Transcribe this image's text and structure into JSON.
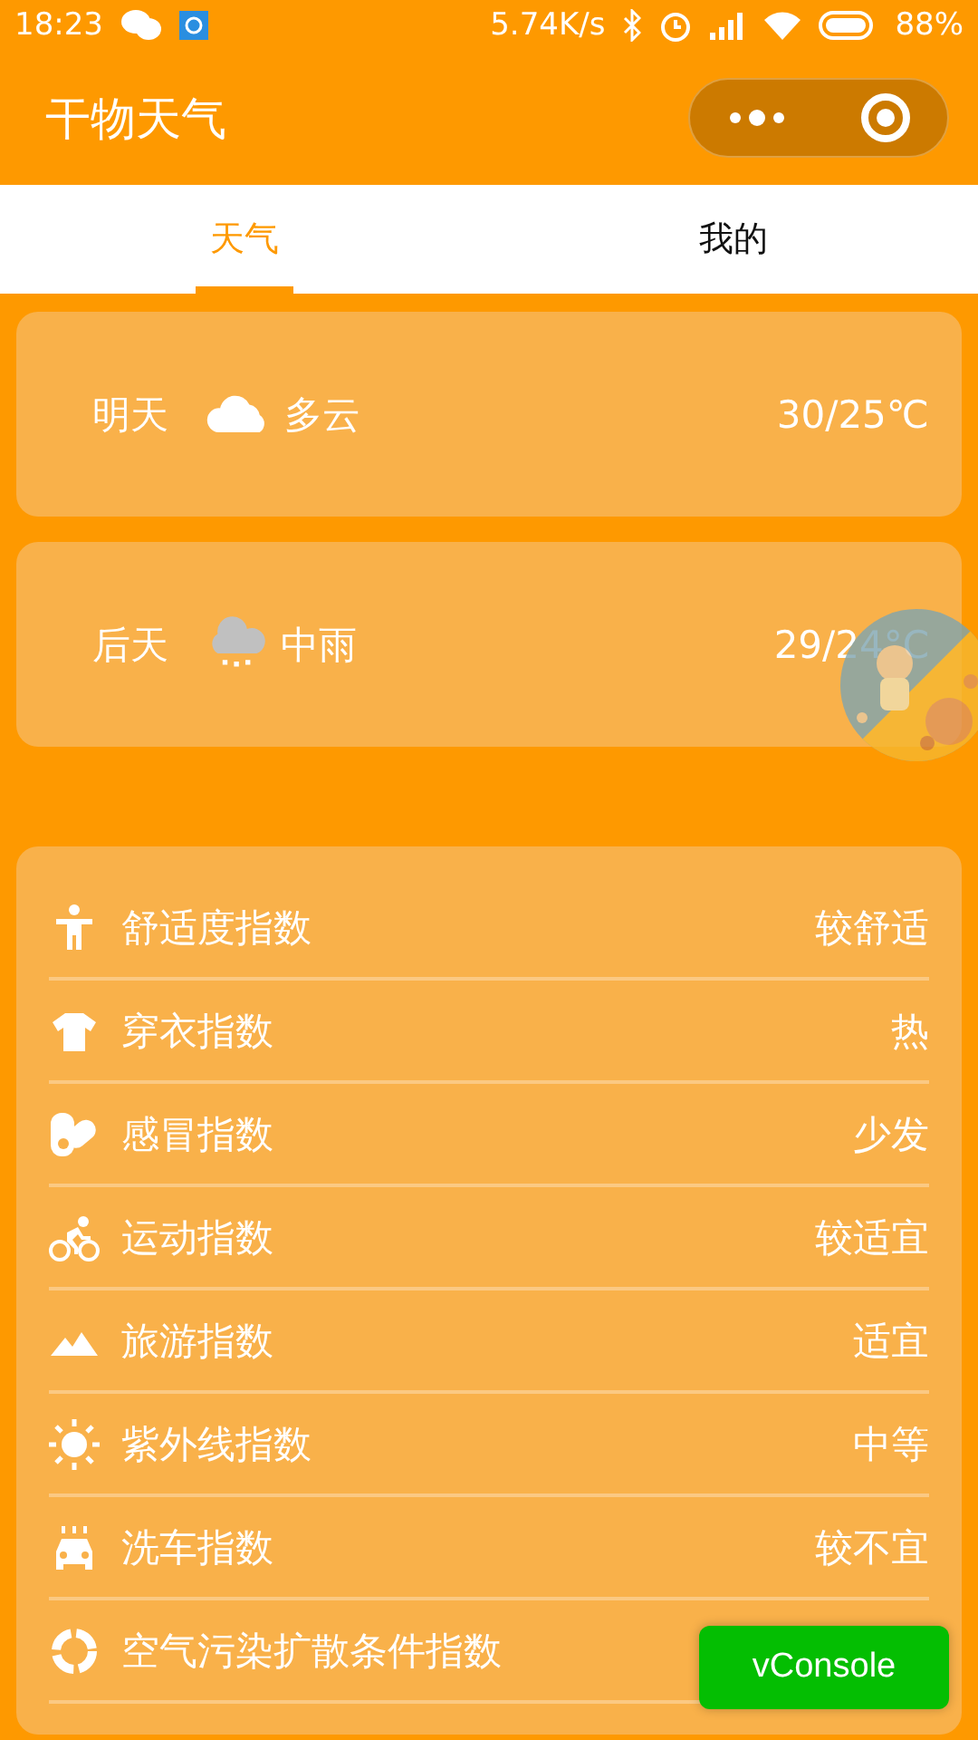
{
  "status_bar": {
    "time": "18:23",
    "speed": "5.74K/s",
    "battery": "88%"
  },
  "header": {
    "title": "干物天气"
  },
  "tabs": [
    {
      "label": "天气",
      "selected": true
    },
    {
      "label": "我的",
      "selected": false
    }
  ],
  "forecast": [
    {
      "day": "明天",
      "kind": "cloudy",
      "condition": "多云",
      "temp": "30/25℃"
    },
    {
      "day": "后天",
      "kind": "rain",
      "condition": "中雨",
      "temp": "29/24°C"
    }
  ],
  "indices": [
    {
      "kind": "comfort",
      "name": "舒适度指数",
      "value": "较舒适"
    },
    {
      "kind": "dressing",
      "name": "穿衣指数",
      "value": "热"
    },
    {
      "kind": "flu",
      "name": "感冒指数",
      "value": "少发"
    },
    {
      "kind": "sport",
      "name": "运动指数",
      "value": "较适宜"
    },
    {
      "kind": "travel",
      "name": "旅游指数",
      "value": "适宜"
    },
    {
      "kind": "uv",
      "name": "紫外线指数",
      "value": "中等"
    },
    {
      "kind": "carwash",
      "name": "洗车指数",
      "value": "较不宜"
    },
    {
      "kind": "air",
      "name": "空气污染扩散条件指数"
    }
  ],
  "debug_button": {
    "label": "vConsole"
  }
}
